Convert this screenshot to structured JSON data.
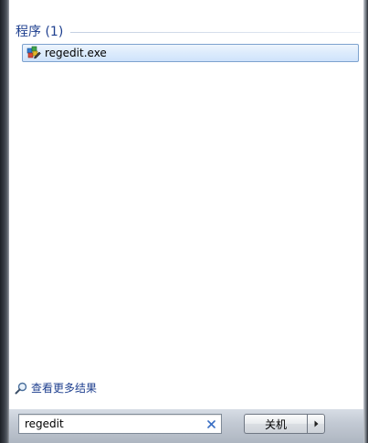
{
  "results": {
    "section_title": "程序 (1)",
    "items": [
      {
        "label": "regedit.exe",
        "icon": "registry-editor-icon"
      }
    ]
  },
  "more_results": {
    "label": "查看更多结果",
    "icon": "magnifier-icon"
  },
  "search": {
    "value": "regedit",
    "clear_icon": "close-icon"
  },
  "power": {
    "shutdown_label": "关机",
    "arrow_icon": "chevron-right-icon"
  },
  "colors": {
    "header_text": "#1e3f8f",
    "selection_border": "#7da2ce",
    "selection_fill": "#dcebfc",
    "clear_x": "#3a6fc4"
  }
}
